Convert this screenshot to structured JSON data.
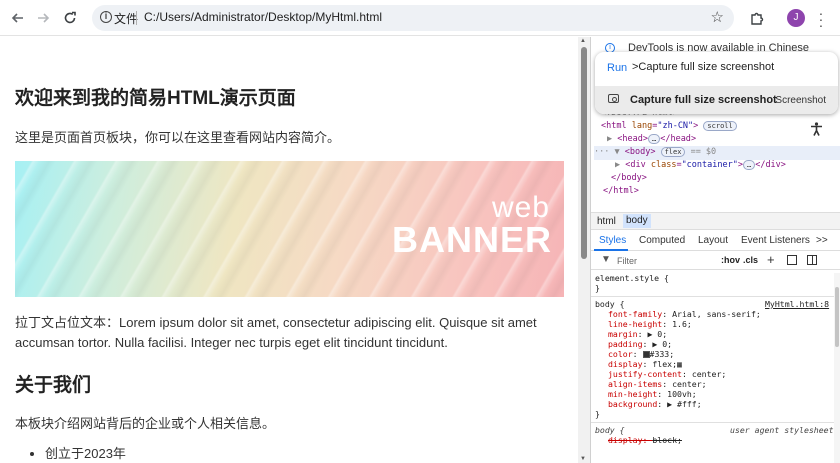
{
  "browser": {
    "file_label": "文件",
    "url": "C:/Users/Administrator/Desktop/MyHtml.html",
    "avatar_letter": "J"
  },
  "page": {
    "h1": "欢迎来到我的简易HTML演示页面",
    "intro": "这里是页面首页板块，你可以在这里查看网站内容简介。",
    "banner_web": "web",
    "banner_text": "BANNER",
    "lorem": "拉丁文占位文本：Lorem ipsum dolor sit amet, consectetur adipiscing elit. Quisque sit amet accumsan tortor. Nulla facilisi. Integer nec turpis eget elit tincidunt tincidunt.",
    "h2": "关于我们",
    "about": "本板块介绍网站背后的企业或个人相关信息。",
    "list": [
      "创立于2023年"
    ]
  },
  "devtools": {
    "info": "DevTools is now available in Chinese",
    "command_menu": {
      "prefix": "Run",
      "query": ">Capture full size screenshot",
      "result_label": "Capture full size screenshot",
      "result_category": "Screenshot"
    },
    "elements": {
      "doctype": "<!DOCTYPE html>",
      "html_open_tag": "html",
      "html_attr": "lang",
      "html_val": "\"zh-CN\"",
      "scroll_badge": "scroll",
      "head": "head",
      "body": "body",
      "flex_badge": "flex",
      "dollar": "== $0",
      "div_attr": "class",
      "div_val": "\"container\"",
      "ellipsis": "…",
      "close_body": "</body>",
      "close_html": "</html>"
    },
    "breadcrumbs": [
      "html",
      "body"
    ],
    "tabs": [
      "Styles",
      "Computed",
      "Layout",
      "Event Listeners",
      ">>"
    ],
    "filter_placeholder": "Filter",
    "hov": ":hov",
    "cls": ".cls",
    "styles": {
      "element_style": "element.style {",
      "close": "}",
      "body_selector": "body {",
      "source": "MyHtml.html:8",
      "rules": [
        {
          "prop": "font-family",
          "value": "Arial, sans-serif;"
        },
        {
          "prop": "line-height",
          "value": "1.6;"
        },
        {
          "prop": "margin",
          "value": "▶ 0;"
        },
        {
          "prop": "padding",
          "value": "▶ 0;"
        },
        {
          "prop": "color",
          "value": "#333;"
        },
        {
          "prop": "display",
          "value": "flex;"
        },
        {
          "prop": "justify-content",
          "value": "center;"
        },
        {
          "prop": "align-items",
          "value": "center;"
        },
        {
          "prop": "min-height",
          "value": "100vh;"
        },
        {
          "prop": "background",
          "value": "▶ #fff;"
        }
      ],
      "ua_selector": "body {",
      "ua_label": "user agent stylesheet",
      "ua_rule_prop": "display",
      "ua_rule_value": "block;"
    }
  },
  "colors": {
    "accent": "#1a73e8",
    "tag": "#881280",
    "attr": "#994500",
    "prop": "#c80000"
  }
}
